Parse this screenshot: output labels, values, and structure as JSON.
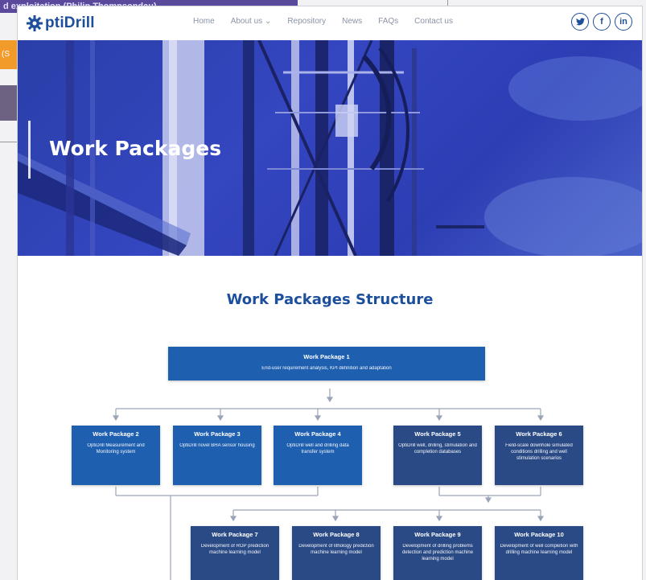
{
  "background": {
    "strip_text": "d exploitation (Philip Thompsondau)",
    "side_text": "(S"
  },
  "brand": {
    "logo_text": "ptiDrill",
    "color": "#1d4f9c"
  },
  "nav": {
    "items": [
      {
        "label": "Home"
      },
      {
        "label": "About us ⌄"
      },
      {
        "label": "Repository"
      },
      {
        "label": "News"
      },
      {
        "label": "FAQs"
      },
      {
        "label": "Contact us"
      }
    ]
  },
  "social": [
    {
      "name": "twitter-icon",
      "glyph": "🐦"
    },
    {
      "name": "facebook-icon",
      "glyph": "f"
    },
    {
      "name": "linkedin-icon",
      "glyph": "in"
    }
  ],
  "hero": {
    "title": "Work Packages"
  },
  "section": {
    "title": "Work Packages Structure"
  },
  "packages": [
    {
      "id": "wp1",
      "title": "Work Package 1",
      "desc": "End-user requirement analysis, KPI definition and adaptation"
    },
    {
      "id": "wp2",
      "title": "Work Package 2",
      "desc": "OptiDrill Measurement and Monitoring system"
    },
    {
      "id": "wp3",
      "title": "Work Package 3",
      "desc": "OptiDrill novel BHA sensor housing"
    },
    {
      "id": "wp4",
      "title": "Work Package 4",
      "desc": "OptiDrill well and drilling data transfer system"
    },
    {
      "id": "wp5",
      "title": "Work Package 5",
      "desc": "OptiDrill well, drilling, stimulation and completion databases"
    },
    {
      "id": "wp6",
      "title": "Work Package 6",
      "desc": "Field-scale downhole simulated conditions drilling and well stimulation scenarios"
    },
    {
      "id": "wp7",
      "title": "Work Package 7",
      "desc": "Development of ROP prediction machine learning model"
    },
    {
      "id": "wp8",
      "title": "Work Package 8",
      "desc": "Development of lithology prediction machine learning model"
    },
    {
      "id": "wp9",
      "title": "Work Package 9",
      "desc": "Development of drilling problems detection and prediction machine learning model"
    },
    {
      "id": "wp10",
      "title": "Work Package 10",
      "desc": "Development of well completion with drilling machine learning model"
    }
  ]
}
